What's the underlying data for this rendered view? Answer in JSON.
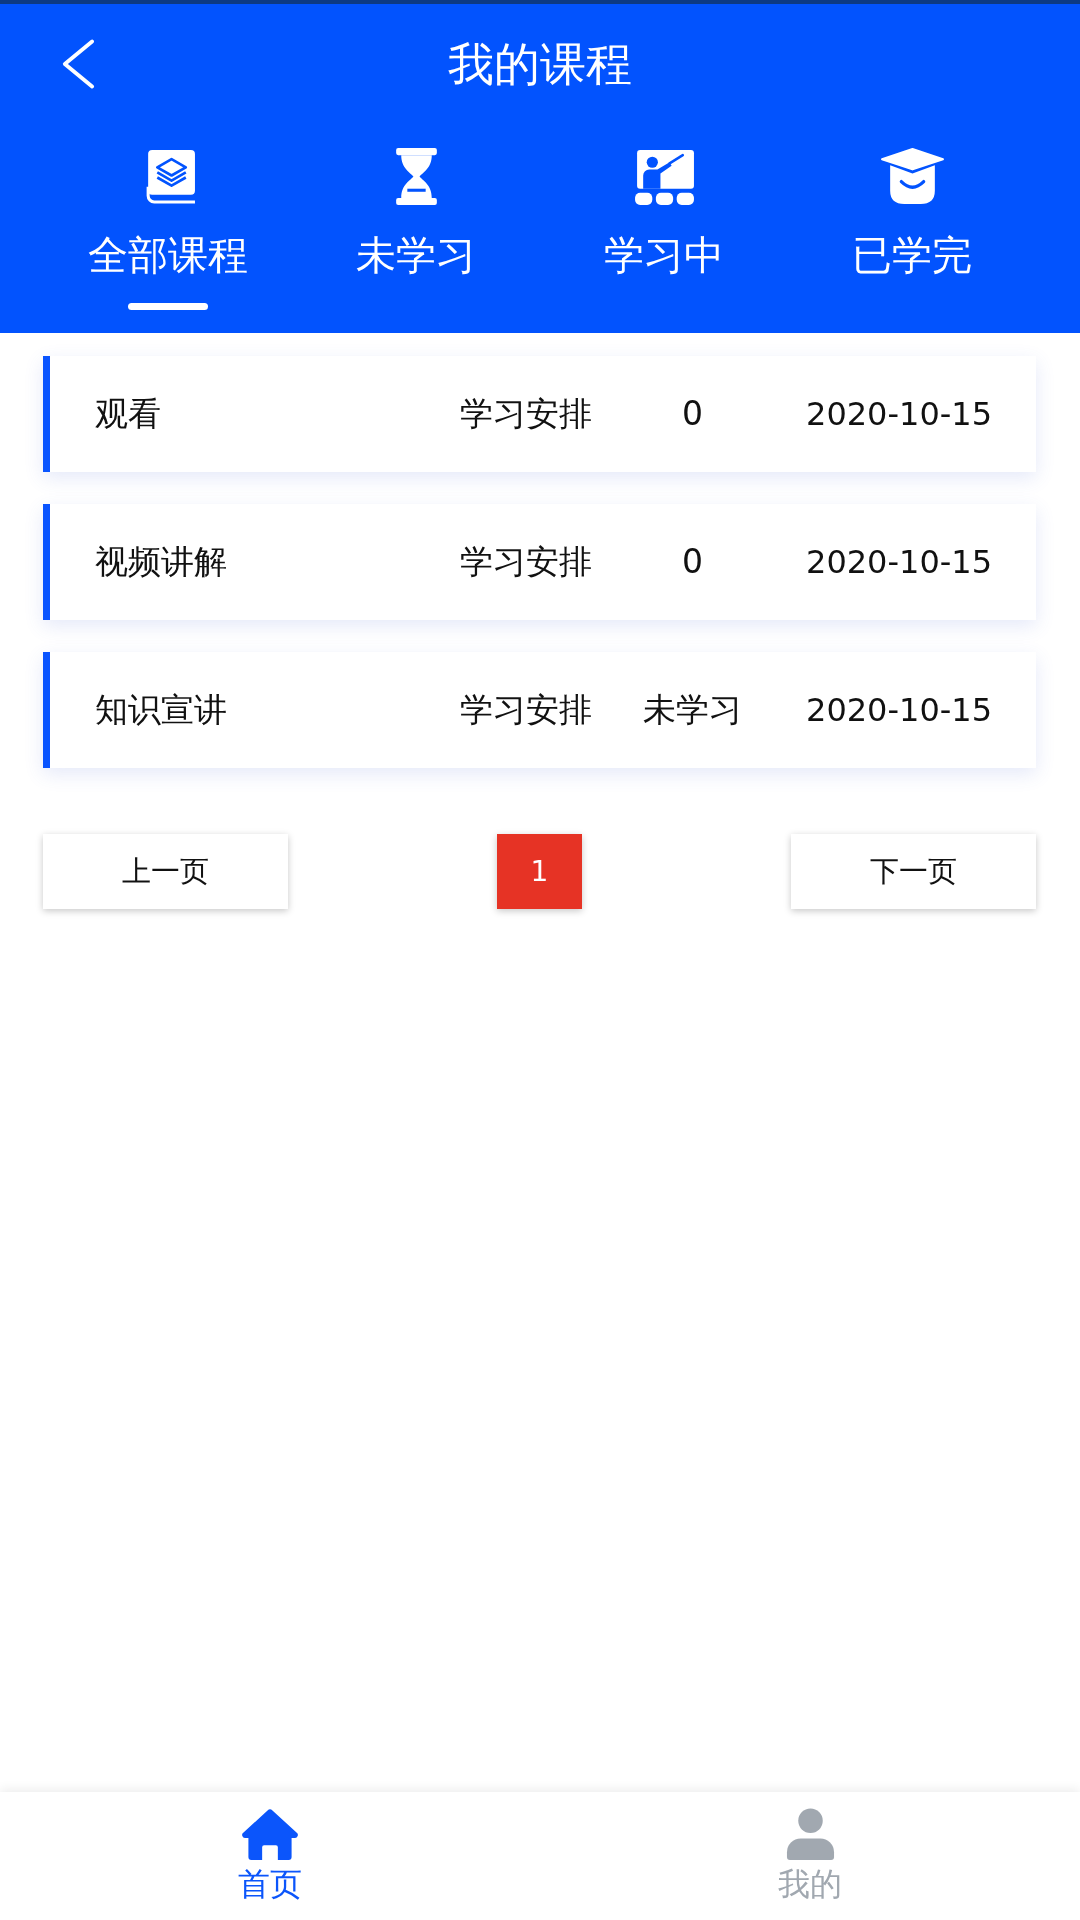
{
  "header": {
    "title": "我的课程"
  },
  "tabs": [
    {
      "label": "全部课程",
      "selected": true
    },
    {
      "label": "未学习",
      "selected": false
    },
    {
      "label": "学习中",
      "selected": false
    },
    {
      "label": "已学完",
      "selected": false
    }
  ],
  "courses": [
    {
      "name": "观看",
      "column_2": "学习安排",
      "column_3": "0",
      "date": "2020-10-15"
    },
    {
      "name": "视频讲解",
      "column_2": "学习安排",
      "column_3": "0",
      "date": "2020-10-15"
    },
    {
      "name": "知识宣讲",
      "column_2": "学习安排",
      "column_3": "未学习",
      "date": "2020-10-15"
    }
  ],
  "pagination": {
    "previous": "上一页",
    "pages": [
      {
        "label": "1",
        "selected": true
      }
    ],
    "next": "下一页"
  },
  "bottom_nav": [
    {
      "label": "首页",
      "selected": true
    },
    {
      "label": "我的",
      "selected": false
    }
  ]
}
